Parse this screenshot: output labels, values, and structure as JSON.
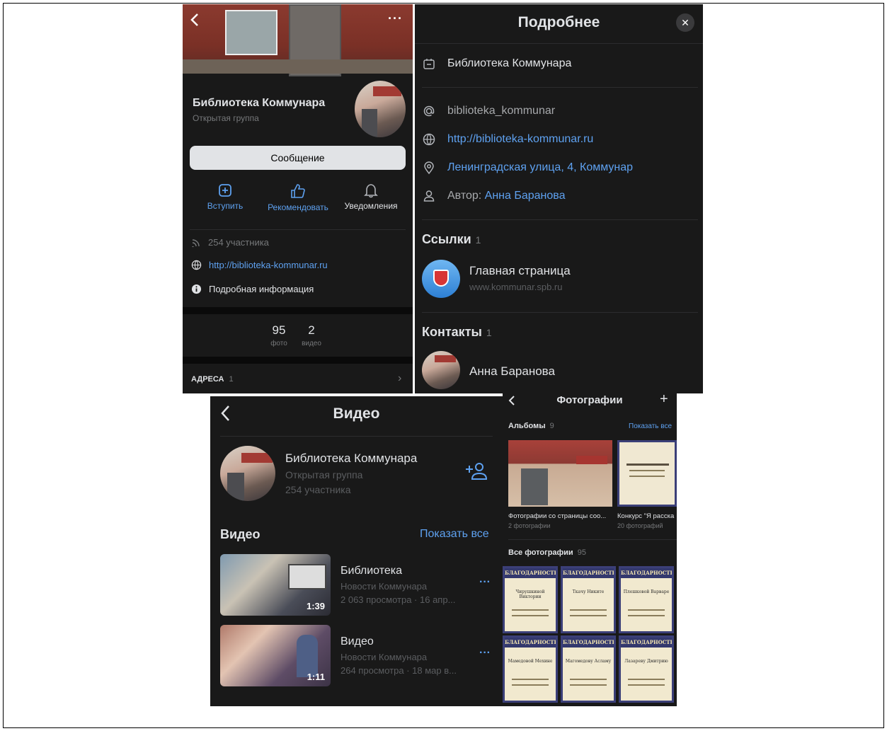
{
  "group": {
    "name": "Библиотека Коммунара",
    "type": "Открытая группа",
    "message_button": "Сообщение",
    "actions": [
      {
        "label": "Вступить",
        "icon": "plus-square-icon"
      },
      {
        "label": "Рекомендовать",
        "icon": "thumbs-up-icon"
      },
      {
        "label": "Уведомления",
        "icon": "bell-icon"
      }
    ],
    "members": "254 участника",
    "url": "http://biblioteka-kommunar.ru",
    "details_link": "Подробная информация",
    "counters": [
      {
        "value": "95",
        "label": "фото"
      },
      {
        "value": "2",
        "label": "видео"
      }
    ],
    "addresses_label": "АДРЕСА",
    "addresses_count": "1"
  },
  "details": {
    "title": "Подробнее",
    "name": "Библиотека Коммунара",
    "screen_name": "biblioteka_kommunar",
    "url": "http://biblioteka-kommunar.ru",
    "address": "Ленинградская улица, 4, Коммунар",
    "author_prefix": "Автор:",
    "author_name": "Анна Баранова",
    "links_title": "Ссылки",
    "links_count": "1",
    "link_name": "Главная страница",
    "link_url": "www.kommunar.spb.ru",
    "contacts_title": "Контакты",
    "contacts_count": "1",
    "contact_name": "Анна Баранова"
  },
  "video": {
    "title": "Видео",
    "group_name": "Библиотека Коммунара",
    "group_type": "Открытая группа",
    "group_members": "254 участника",
    "section_title": "Видео",
    "show_all": "Показать все",
    "items": [
      {
        "title": "Библиотека",
        "channel": "Новости Коммунара",
        "meta": "2 063 просмотра · 16 апр...",
        "duration": "1:39"
      },
      {
        "title": "Видео",
        "channel": "Новости Коммунара",
        "meta": "264 просмотра · 18 мар в...",
        "duration": "1:11"
      }
    ]
  },
  "photos": {
    "title": "Фотографии",
    "albums_label": "Альбомы",
    "albums_count": "9",
    "show_all": "Показать все",
    "albums": [
      {
        "name": "Фотографии со страницы соо...",
        "count": "2 фотографии"
      },
      {
        "name": "Конкурс \"Я расска",
        "count": "20 фотографий"
      }
    ],
    "all_label": "Все фотографии",
    "all_count": "95",
    "cert_header": "БЛАГОДАРНОСТЬ",
    "cert_names": [
      "Чирушкиной Виктории",
      "Ткачу Никите",
      "Плешковой Варваре",
      "Мамедовой Мехине",
      "Магомедову Асламу",
      "Лазареву Дмитрию"
    ]
  },
  "colors": {
    "background": "#191919",
    "text": "#e1e3e6",
    "muted": "#76787a",
    "accent": "#5ea1f0"
  }
}
